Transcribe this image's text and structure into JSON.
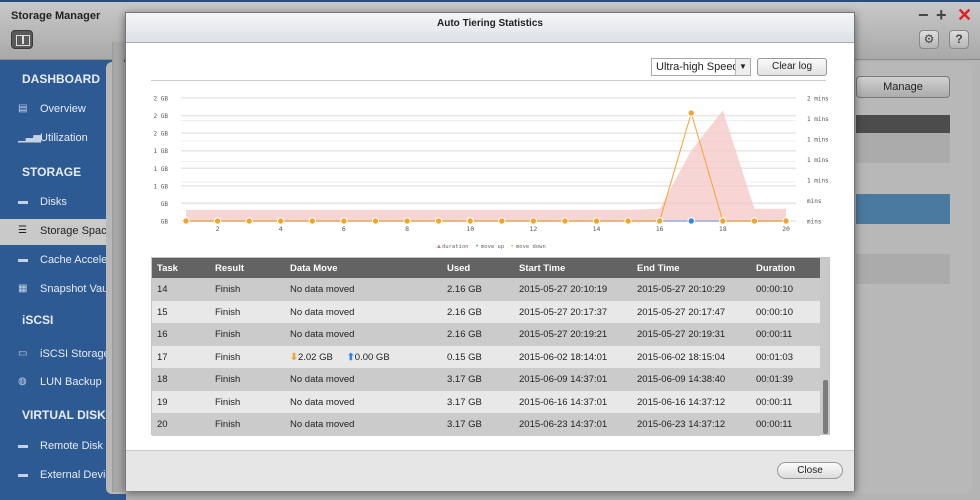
{
  "app": {
    "title": "Storage Manager",
    "controls": {
      "minimize": "−",
      "maximize": "+",
      "close": "✕",
      "settings_icon": "⚙",
      "help": "?"
    }
  },
  "sidebar": {
    "sections": [
      {
        "heading": "DASHBOARD",
        "items": [
          {
            "label": "Overview",
            "icon": "overview-icon",
            "glyph": "▤"
          },
          {
            "label": "Utilization",
            "icon": "utilization-icon",
            "glyph": "▁▃▅"
          }
        ]
      },
      {
        "heading": "STORAGE",
        "items": [
          {
            "label": "Disks",
            "icon": "disk-icon",
            "glyph": "▬"
          },
          {
            "label": "Storage Space",
            "icon": "storage-space-icon",
            "glyph": "☰",
            "active": true
          },
          {
            "label": "Cache Accelerat",
            "icon": "cache-icon",
            "glyph": "▬"
          },
          {
            "label": "Snapshot Vault",
            "icon": "snapshot-vault-icon",
            "glyph": "▦"
          }
        ]
      },
      {
        "heading": "iSCSI",
        "items": [
          {
            "label": "iSCSI Storage",
            "icon": "iscsi-storage-icon",
            "glyph": "▭"
          },
          {
            "label": "LUN Backup",
            "icon": "lun-backup-icon",
            "glyph": "◍"
          }
        ]
      },
      {
        "heading": "VIRTUAL DISK",
        "items": [
          {
            "label": "Remote Disk",
            "icon": "remote-disk-icon",
            "glyph": "▬"
          },
          {
            "label": "External Device",
            "icon": "external-device-icon",
            "glyph": "▬"
          }
        ]
      }
    ]
  },
  "background": {
    "manage_label": "Manage"
  },
  "modal": {
    "title": "Auto Tiering Statistics",
    "tier_select": {
      "value": "Ultra-high Speed"
    },
    "clear_log_label": "Clear log",
    "close_label": "Close"
  },
  "chart_data": {
    "type": "line",
    "title": "",
    "x": [
      1,
      2,
      3,
      4,
      5,
      6,
      7,
      8,
      9,
      10,
      11,
      12,
      13,
      14,
      15,
      16,
      17,
      18,
      19,
      20
    ],
    "x_ticks": [
      2,
      4,
      6,
      8,
      10,
      12,
      14,
      16,
      18,
      20
    ],
    "y_left_ticks": [
      "2 GB",
      "2 GB",
      "2 GB",
      "1 GB",
      "1 GB",
      "1 GB",
      "GB",
      "GB"
    ],
    "y_right_ticks": [
      "2 mins",
      "1 mins",
      "1 mins",
      "1 mins",
      "1 mins",
      "mins",
      "mins"
    ],
    "y_left_range_gb": [
      0,
      2.3
    ],
    "y_right_range_s": [
      0,
      110
    ],
    "series": [
      {
        "name": "duration",
        "type": "area",
        "axis": "right",
        "unit": "s",
        "color": "#f4c7c7",
        "values": [
          10,
          10,
          10,
          10,
          10,
          10,
          10,
          10,
          10,
          10,
          10,
          10,
          10,
          10,
          10,
          11,
          63,
          99,
          11,
          11
        ]
      },
      {
        "name": "move up",
        "type": "line",
        "axis": "left",
        "unit": "GB",
        "color": "#2f86e6",
        "values": [
          0,
          0,
          0,
          0,
          0,
          0,
          0,
          0,
          0,
          0,
          0,
          0,
          0,
          0,
          0,
          0,
          0.0,
          0,
          0,
          0
        ]
      },
      {
        "name": "move down",
        "type": "line",
        "axis": "left",
        "unit": "GB",
        "color": "#f2a432",
        "values": [
          0,
          0,
          0,
          0,
          0,
          0,
          0,
          0,
          0,
          0,
          0,
          0,
          0,
          0,
          0,
          0,
          2.02,
          0,
          0,
          0
        ]
      }
    ],
    "legend": {
      "position": "bottom-center",
      "entries": [
        "duration",
        "move up",
        "move down"
      ]
    },
    "grid": true
  },
  "table": {
    "columns": [
      "Task",
      "Result",
      "Data Move",
      "Used",
      "Start Time",
      "End Time",
      "Duration"
    ],
    "rows": [
      {
        "task": "14",
        "result": "Finish",
        "move": "No data moved",
        "used": "2.16 GB",
        "start": "2015-05-27 20:10:19",
        "end": "2015-05-27 20:10:29",
        "duration": "00:00:10"
      },
      {
        "task": "15",
        "result": "Finish",
        "move": "No data moved",
        "used": "2.16 GB",
        "start": "2015-05-27 20:17:37",
        "end": "2015-05-27 20:17:47",
        "duration": "00:00:10"
      },
      {
        "task": "16",
        "result": "Finish",
        "move": "No data moved",
        "used": "2.16 GB",
        "start": "2015-05-27 20:19:21",
        "end": "2015-05-27 20:19:31",
        "duration": "00:00:11"
      },
      {
        "task": "17",
        "result": "Finish",
        "move": "",
        "move_down": "2.02 GB",
        "move_up": "0.00 GB",
        "used": "0.15 GB",
        "start": "2015-06-02 18:14:01",
        "end": "2015-06-02 18:15:04",
        "duration": "00:01:03"
      },
      {
        "task": "18",
        "result": "Finish",
        "move": "No data moved",
        "used": "3.17 GB",
        "start": "2015-06-09 14:37:01",
        "end": "2015-06-09 14:38:40",
        "duration": "00:01:39"
      },
      {
        "task": "19",
        "result": "Finish",
        "move": "No data moved",
        "used": "3.17 GB",
        "start": "2015-06-16 14:37:01",
        "end": "2015-06-16 14:37:12",
        "duration": "00:00:11"
      },
      {
        "task": "20",
        "result": "Finish",
        "move": "No data moved",
        "used": "3.17 GB",
        "start": "2015-06-23 14:37:01",
        "end": "2015-06-23 14:37:12",
        "duration": "00:00:11"
      }
    ]
  }
}
